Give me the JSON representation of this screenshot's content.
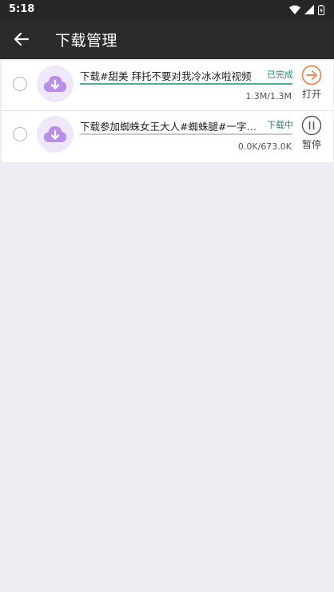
{
  "status_bar": {
    "time": "5:18",
    "icons": [
      "wifi-icon",
      "signal-icon",
      "battery-icon"
    ]
  },
  "app_bar": {
    "back_icon": "arrow-left-icon",
    "title": "下载管理"
  },
  "colors": {
    "app_bar": "#2b2b2b",
    "status_bar": "#262626",
    "complete": "#1f8c73",
    "open_icon": "#ee8a52",
    "thumb_bg": "#efe8fa",
    "thumb_icon": "#b98ee8",
    "background": "#eeedf3"
  },
  "downloads": [
    {
      "title": "下载#甜美 拜托不要对我冷冰冰啦视频",
      "status": "已完成",
      "size": "1.3M/1.3M",
      "progress": 1.0,
      "action": {
        "label": "打开",
        "icon": "arrow-right-circle-icon"
      }
    },
    {
      "title": "下载参加蜘蛛女王大人#蜘蛛腿#一字马#...",
      "status": "下载中",
      "size": "0.0K/673.0K",
      "progress": 0.0,
      "action": {
        "label": "暂停",
        "icon": "pause-circle-icon"
      }
    }
  ]
}
